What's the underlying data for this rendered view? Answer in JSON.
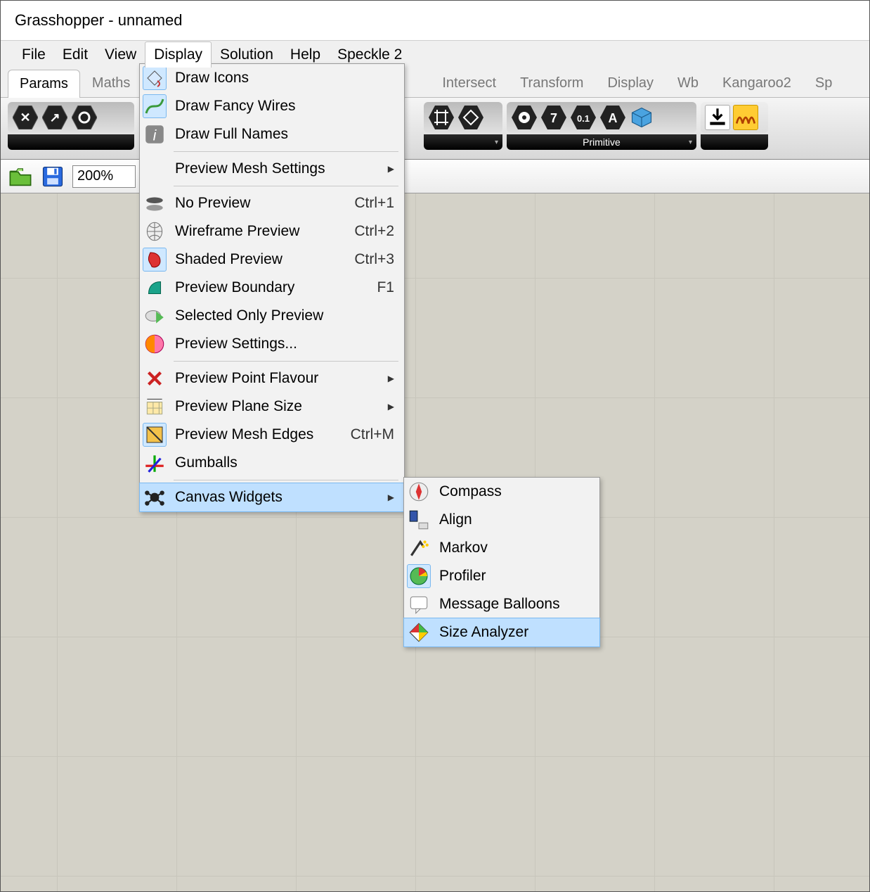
{
  "title": "Grasshopper - unnamed",
  "menubar": [
    "File",
    "Edit",
    "View",
    "Display",
    "Solution",
    "Help",
    "Speckle 2"
  ],
  "menubar_open": 3,
  "tabs": [
    "Params",
    "Maths",
    "Intersect",
    "Transform",
    "Display",
    "Wb",
    "Kangaroo2",
    "Sp"
  ],
  "tabs_active": 0,
  "ribbon_group_label": "Primitive",
  "zoom": "200%",
  "display_menu": [
    {
      "type": "item",
      "icon": "bucket-icon",
      "sel": true,
      "label": "Draw Icons"
    },
    {
      "type": "item",
      "icon": "wires-icon",
      "sel": true,
      "label": "Draw Fancy Wires"
    },
    {
      "type": "item",
      "icon": "info-icon",
      "label": "Draw Full Names"
    },
    {
      "type": "sep"
    },
    {
      "type": "item",
      "label": "Preview Mesh Settings",
      "submenu": true
    },
    {
      "type": "sep"
    },
    {
      "type": "item",
      "icon": "nopreview-icon",
      "label": "No Preview",
      "shortcut": "Ctrl+1"
    },
    {
      "type": "item",
      "icon": "wireframe-icon",
      "label": "Wireframe Preview",
      "shortcut": "Ctrl+2"
    },
    {
      "type": "item",
      "icon": "shaded-icon",
      "sel": true,
      "label": "Shaded Preview",
      "shortcut": "Ctrl+3"
    },
    {
      "type": "item",
      "icon": "boundary-icon",
      "label": "Preview Boundary",
      "shortcut": "F1"
    },
    {
      "type": "item",
      "icon": "selected-only-icon",
      "label": "Selected Only Preview"
    },
    {
      "type": "item",
      "icon": "settings-icon",
      "label": "Preview Settings..."
    },
    {
      "type": "sep"
    },
    {
      "type": "item",
      "icon": "point-flavour-icon",
      "label": "Preview Point Flavour",
      "submenu": true
    },
    {
      "type": "item",
      "icon": "plane-size-icon",
      "label": "Preview Plane Size",
      "submenu": true
    },
    {
      "type": "item",
      "icon": "mesh-edges-icon",
      "sel": true,
      "label": "Preview Mesh Edges",
      "shortcut": "Ctrl+M"
    },
    {
      "type": "item",
      "icon": "gumball-icon",
      "label": "Gumballs"
    },
    {
      "type": "sep"
    },
    {
      "type": "item",
      "icon": "widgets-icon",
      "label": "Canvas Widgets",
      "submenu": true,
      "hl": true
    }
  ],
  "widgets_menu": [
    {
      "icon": "compass-icon",
      "label": "Compass"
    },
    {
      "icon": "align-icon",
      "label": "Align"
    },
    {
      "icon": "markov-icon",
      "label": "Markov"
    },
    {
      "icon": "profiler-icon",
      "label": "Profiler",
      "sel": true
    },
    {
      "icon": "balloons-icon",
      "label": "Message Balloons"
    },
    {
      "icon": "size-analyzer-icon",
      "label": "Size Analyzer",
      "hl": true
    }
  ]
}
